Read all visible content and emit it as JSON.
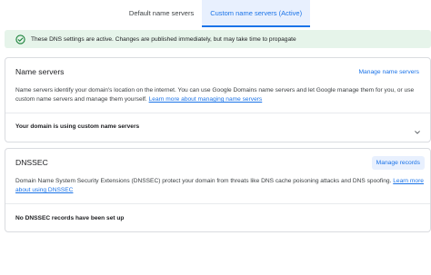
{
  "tabs": [
    {
      "label": "Default name servers",
      "active": false
    },
    {
      "label": "Custom name servers (Active)",
      "active": true
    }
  ],
  "banner": {
    "icon": "check-circle-icon",
    "text": "These DNS settings are active. Changes are published immediately, but may take time to propagate",
    "color": "#e6f4ea",
    "icon_color": "#188038"
  },
  "name_servers": {
    "title": "Name servers",
    "action_link": "Manage name servers",
    "description": "Name servers identify your domain's location on the internet. You can use Google Domains name servers and let Google manage them for you, or use custom name servers and manage them yourself.",
    "learn_more": "Learn more about managing name servers",
    "status": "Your domain is using custom name servers",
    "status_icon": "chevron-down-icon"
  },
  "dnssec": {
    "title": "DNSSEC",
    "action_button": "Manage records",
    "description": "Domain Name System Security Extensions (DNSSEC) protect your domain from threats like DNS cache poisoning attacks and DNS spoofing.",
    "learn_more": "Learn more about using DNSSEC",
    "status": "No DNSSEC records have been set up"
  },
  "accent_color": "#1a73e8"
}
